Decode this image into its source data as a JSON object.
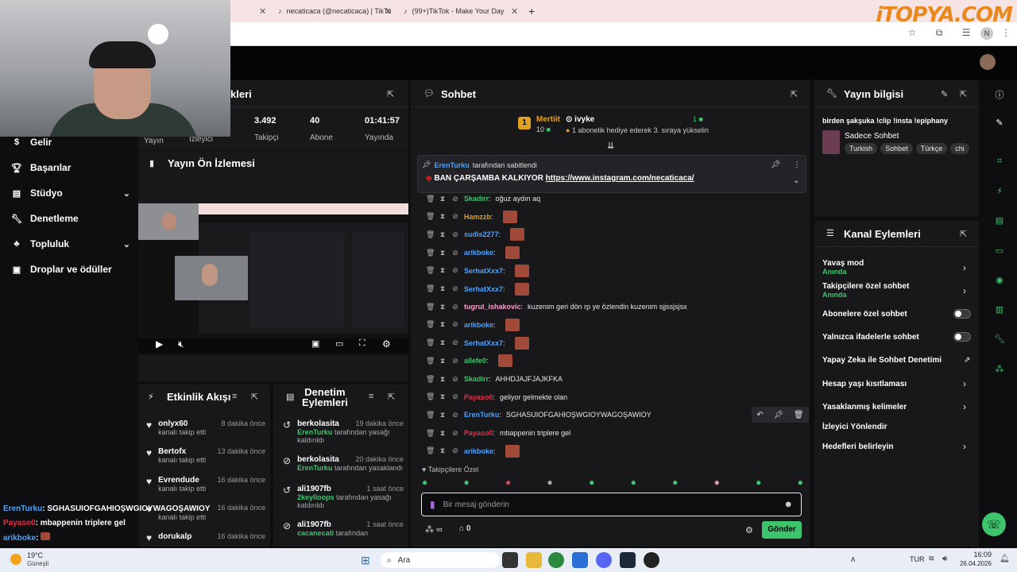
{
  "browser": {
    "tabs": [
      {
        "label": "necaticaca (@necaticaca) | TikTo"
      },
      {
        "label": "(99+)TikTok - Make Your Day"
      }
    ],
    "logo": "iTOPYA.COM"
  },
  "left_nav": {
    "items": [
      {
        "label": "Gelir"
      },
      {
        "label": "Başarılar"
      },
      {
        "label": "Stüdyo"
      },
      {
        "label": "Denetleme"
      },
      {
        "label": "Topluluk"
      },
      {
        "label": "Droplar ve ödüller"
      }
    ]
  },
  "stats_panel": {
    "title_fragment": "kleri",
    "stats": [
      {
        "value": "",
        "label": "Yayın"
      },
      {
        "value": "",
        "label": "İzleyici"
      },
      {
        "value": "3.492",
        "label": "Takipçi"
      },
      {
        "value": "40",
        "label": "Abone"
      },
      {
        "value": "01:41:57",
        "label": "Yayında"
      }
    ]
  },
  "preview_panel": {
    "title": "Yayın Ön İzlemesi"
  },
  "activity_panel": {
    "title": "Etkinlik Akışı",
    "items": [
      {
        "name": "onlyx60",
        "sub": "kanalı takip etti",
        "time": "8 dakika önce"
      },
      {
        "name": "Bertofx",
        "sub": "kanalı takip etti",
        "time": "13 dakika önce"
      },
      {
        "name": "Evrendude",
        "sub": "kanalı takip etti",
        "time": "16 dakika önce"
      },
      {
        "name": "",
        "sub": "kanalı takip etti",
        "time": "16 dakika önce"
      },
      {
        "name": "dorukalp",
        "sub": "",
        "time": "16 dakika önce"
      }
    ]
  },
  "mod_panel": {
    "title_line1": "Denetim",
    "title_line2": "Eylemleri",
    "items": [
      {
        "name": "berkolasita",
        "time": "19 dakika önce",
        "actor": "ErenTurku",
        "text": "tarafından yasağı kaldırıldı"
      },
      {
        "name": "berkolasita",
        "time": "20 dakika önce",
        "actor": "ErenTurku",
        "text": "tarafından yasaklandı"
      },
      {
        "name": "ali1907fb",
        "time": "1 saat önce",
        "actor": "2keyIloops",
        "text": "tarafından yasağı kaldırıldı"
      },
      {
        "name": "ali1907fb",
        "time": "1 saat önce",
        "actor": "cacanecati",
        "text": "tarafından"
      }
    ]
  },
  "chat": {
    "title": "Sohbet",
    "leaderboard": [
      {
        "name": "Mertiit",
        "rank": "1",
        "count": "10"
      },
      {
        "name": "ivyke",
        "count": "1"
      }
    ],
    "sub_text": "1 abonelik hediye ederek 3. sıraya yükselin",
    "pinned": {
      "by": "ErenTurku",
      "by_text": "tarafından sabitlendi",
      "message": "BAN ÇARŞAMBA KALKIYOR",
      "link": "https://www.instagram.com/necaticaca/"
    },
    "messages": [
      {
        "user": "Skadirr",
        "color": "#3ec46d",
        "text": "oğuz aydın aq",
        "emote": false
      },
      {
        "user": "Hamzzb",
        "color": "#e0a020",
        "text": "",
        "emote": true
      },
      {
        "user": "sudis2277",
        "color": "#4aa3ff",
        "text": "",
        "emote": true
      },
      {
        "user": "arikboke",
        "color": "#4aa3ff",
        "text": "",
        "emote": true
      },
      {
        "user": "SerhatXxx7",
        "color": "#4aa3ff",
        "text": "",
        "emote": true
      },
      {
        "user": "SerhatXxx7",
        "color": "#4aa3ff",
        "text": "",
        "emote": true
      },
      {
        "user": "tugrul_ishakovic",
        "color": "#ff9ecf",
        "text": "kuzenim geri dön rp ye özlendin kuzenim sjjssjsjsx",
        "emote": false
      },
      {
        "user": "arikboke",
        "color": "#4aa3ff",
        "text": "",
        "emote": true
      },
      {
        "user": "SerhatXxx7",
        "color": "#4aa3ff",
        "text": "",
        "emote": true
      },
      {
        "user": "allefe0",
        "color": "#3ec46d",
        "text": "",
        "emote": true
      },
      {
        "user": "Skadirr",
        "color": "#3ec46d",
        "text": "AHHDJAJFJAJKFKA",
        "emote": false
      },
      {
        "user": "Payaso0",
        "color": "#e0304a",
        "text": "geliyor gelmekte olan",
        "emote": false
      },
      {
        "user": "ErenTurku",
        "color": "#4aa3ff",
        "text": "SGHASUIOFGAHIOŞWGIOYWAGOŞAWIOY",
        "emote": false
      },
      {
        "user": "Payaso0",
        "color": "#e0304a",
        "text": "mbappenin triplere gel",
        "emote": false
      },
      {
        "user": "arikboke",
        "color": "#4aa3ff",
        "text": "",
        "emote": true
      }
    ],
    "followers_only": "Takipçilere Özel",
    "input_placeholder": "Bir mesaj gönderin",
    "count": "0",
    "send_label": "Gönder"
  },
  "stream_info": {
    "title": "Yayın bilgisi",
    "stream_title": "birden şakşuka !clip !insta !epiphany",
    "category": "Sadece Sohbet",
    "tags": [
      "Turkish",
      "Sohbet",
      "Türkçe",
      "chi"
    ]
  },
  "channel_actions": {
    "title": "Kanal Eylemleri",
    "items": [
      {
        "label": "Yavaş mod",
        "sub": "Anında",
        "kind": "chevron"
      },
      {
        "label": "Takipçilere özel sohbet",
        "sub": "Anında",
        "kind": "chevron"
      },
      {
        "label": "Abonelere özel sohbet",
        "sub": "",
        "kind": "toggle"
      },
      {
        "label": "Yalnızca ifadelerle sohbet",
        "sub": "",
        "kind": "toggle"
      },
      {
        "label": "Yapay Zeka ile Sohbet Denetimi",
        "sub": "",
        "kind": "external"
      },
      {
        "label": "Hesap yaşı kısıtlaması",
        "sub": "",
        "kind": "chevron"
      },
      {
        "label": "Yasaklanmış kelimeler",
        "sub": "",
        "kind": "chevron"
      },
      {
        "label": "İzleyici Yönlendir",
        "sub": "",
        "kind": "none"
      },
      {
        "label": "Hedefleri belirleyin",
        "sub": "",
        "kind": "chevron"
      }
    ]
  },
  "overlay_chat": [
    {
      "user": "ErenTurku",
      "color": "#4aa3ff",
      "text": "SGHASUIOFGAHIOŞWGIOYWAGOŞAWIOY"
    },
    {
      "user": "Payaso0",
      "color": "#e0304a",
      "text": "mbappenin triplere gel"
    },
    {
      "user": "arikboke",
      "color": "#4aa3ff",
      "text": ""
    }
  ],
  "taskbar": {
    "weather_temp": "19°C",
    "weather_desc": "Güneşli",
    "search": "Ara",
    "lang": "TUR",
    "time": "16:09",
    "date": "26.04.2026"
  }
}
